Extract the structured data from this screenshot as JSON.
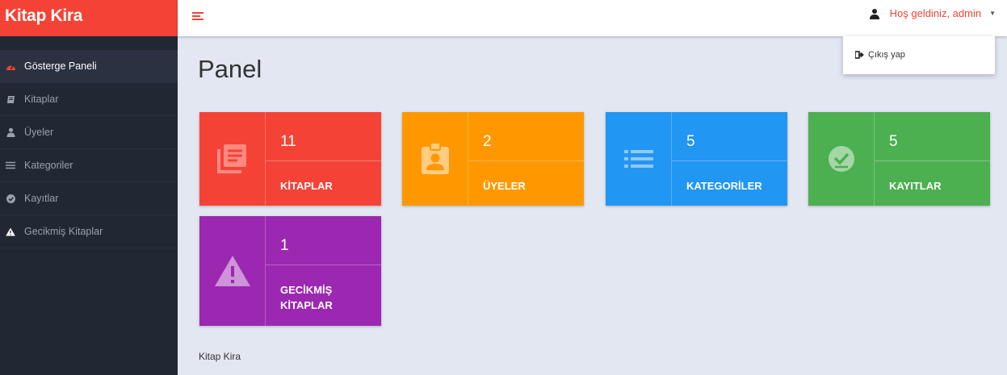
{
  "brand": {
    "title": "Kitap Kira"
  },
  "topbar": {
    "greeting": "Hoş geldiniz, admin"
  },
  "dropdown": {
    "logout_label": "Çıkış yap"
  },
  "sidebar": {
    "items": [
      {
        "label": "Gösterge Paneli",
        "icon": "dashboard-icon"
      },
      {
        "label": "Kitaplar",
        "icon": "book-icon"
      },
      {
        "label": "Üyeler",
        "icon": "user-icon"
      },
      {
        "label": "Kategoriler",
        "icon": "list-icon"
      },
      {
        "label": "Kayıtlar",
        "icon": "check-circle-icon"
      },
      {
        "label": "Gecikmiş Kitaplar",
        "icon": "warning-icon"
      }
    ]
  },
  "main": {
    "title": "Panel",
    "cards": [
      {
        "count": "11",
        "label": "KİTAPLAR",
        "color": "#f44336",
        "icon": "library-books-icon"
      },
      {
        "count": "2",
        "label": "ÜYELER",
        "color": "#ff9800",
        "icon": "badge-icon"
      },
      {
        "count": "5",
        "label": "KATEGORİLER",
        "color": "#2196f3",
        "icon": "list-icon"
      },
      {
        "count": "5",
        "label": "KAYITLAR",
        "color": "#4caf50",
        "icon": "check-circle-icon"
      },
      {
        "count": "1",
        "label": "GECİKMİŞ KİTAPLAR",
        "color": "#9c27b0",
        "icon": "warning-icon"
      }
    ]
  },
  "footer": {
    "text": "Kitap Kira"
  }
}
